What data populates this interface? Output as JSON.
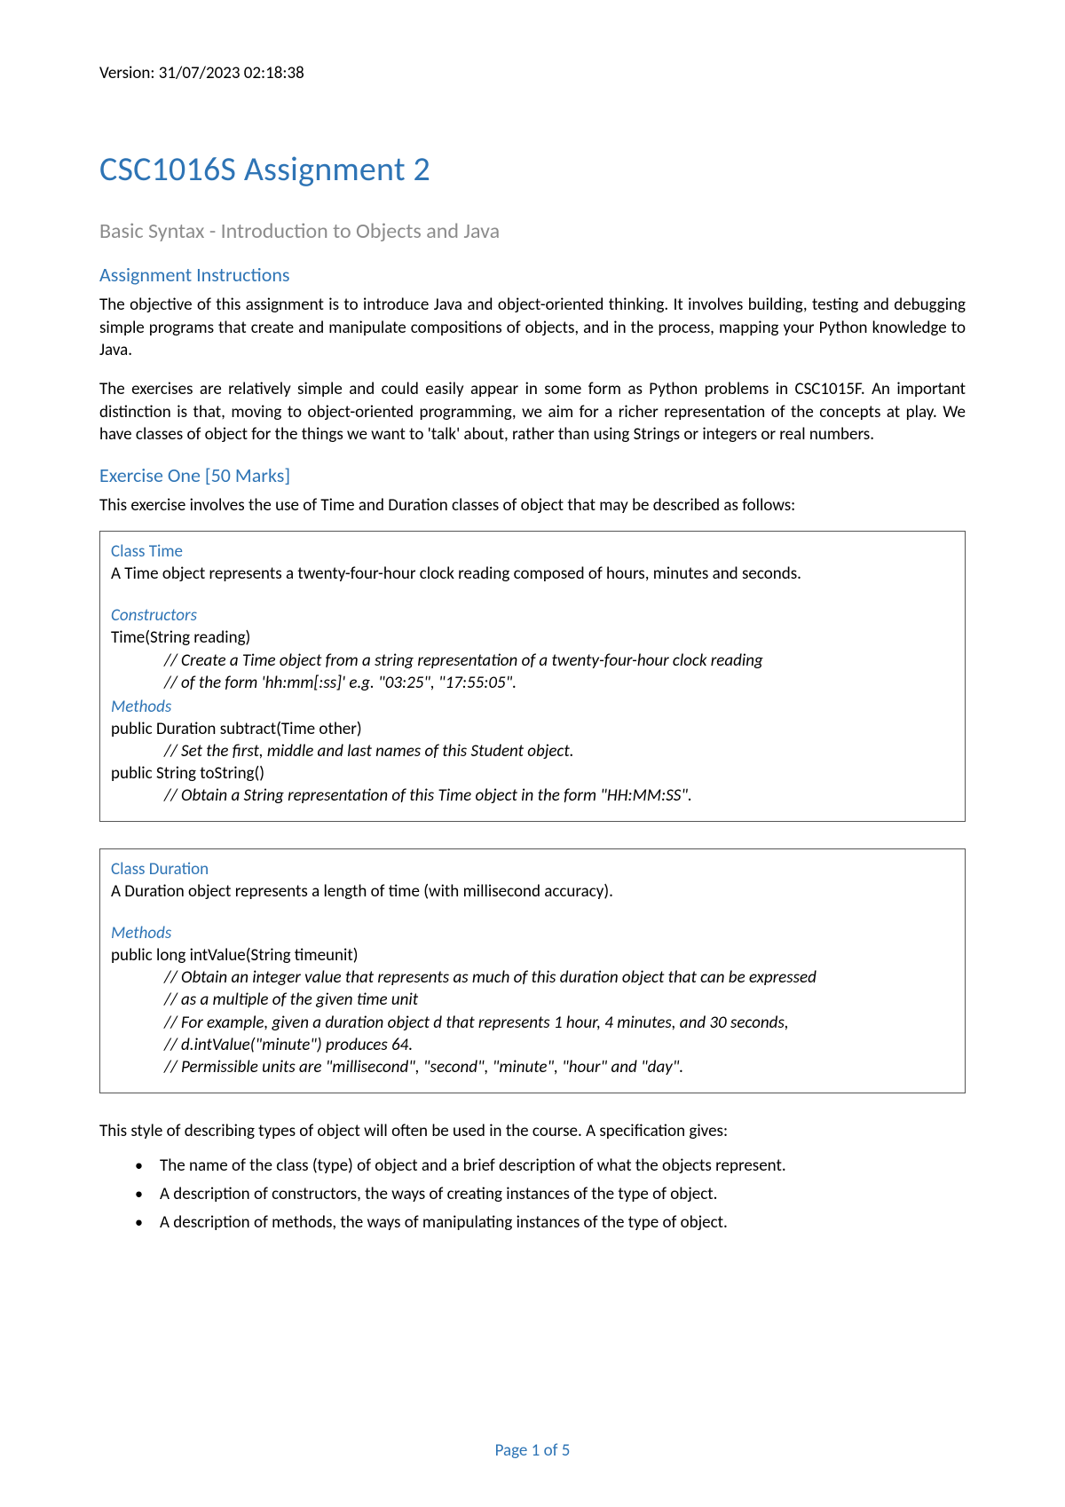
{
  "version": "Version: 31/07/2023 02:18:38",
  "title": "CSC1016S Assignment 2",
  "subtitle": "Basic Syntax - Introduction to Objects and Java",
  "sections": {
    "instructions": {
      "heading": "Assignment Instructions",
      "p1": "The objective of this assignment is to introduce Java and object-oriented thinking. It involves building, testing and debugging simple programs that create and manipulate compositions of objects, and in the process, mapping your Python knowledge to Java.",
      "p2": "The exercises are relatively simple and could easily appear in some form as Python problems in CSC1015F. An important distinction is that, moving to object-oriented programming, we aim for a richer representation of the concepts at play. We have classes of object for the things we want to 'talk' about, rather than using Strings or integers or real numbers."
    },
    "ex1": {
      "heading": "Exercise One [50 Marks]",
      "intro": "This exercise involves the use of Time and Duration classes of object that may be described as follows:"
    }
  },
  "box_time": {
    "title": "Class Time",
    "desc": "A Time object represents a twenty-four-hour clock reading composed of hours, minutes and seconds.",
    "constructors_label": "Constructors",
    "ctor_sig": "Time(String reading)",
    "ctor_c1": "// Create a Time object from a string representation of a twenty-four-hour clock reading",
    "ctor_c2": "// of the form 'hh:mm[:ss]' e.g. \"03:25\", \"17:55:05\".",
    "methods_label": "Methods",
    "m1_sig": "public Duration subtract(Time other)",
    "m1_c1": "// Set the first, middle and last names of this Student object.",
    "m2_sig": "public String toString()",
    "m2_c1": "// Obtain a String representation of this Time object in the form \"HH:MM:SS\"."
  },
  "box_duration": {
    "title": "Class Duration",
    "desc": "A Duration object represents a length of time (with millisecond accuracy).",
    "methods_label": "Methods",
    "m1_sig": "public long intValue(String timeunit)",
    "m1_c1": "// Obtain an integer value that represents as much of this duration object that can be expressed",
    "m1_c2": "// as a multiple of the given time unit",
    "m1_c3": "// For example, given a duration object d that represents 1 hour, 4 minutes, and 30 seconds,",
    "m1_c4": "//  d.intValue(\"minute\") produces 64.",
    "m1_c5": "// Permissible units are \"millisecond\", \"second\", \"minute\", \"hour\" and \"day\"."
  },
  "closing": {
    "p": "This style of describing types of object will often be used in the course. A specification gives:",
    "b1": "The name of the class (type) of object and a brief description of what the objects represent.",
    "b2": "A description of constructors, the ways of creating instances of the type of object.",
    "b3": "A description of methods, the ways of manipulating instances of the type of object."
  },
  "footer": "Page 1 of 5"
}
